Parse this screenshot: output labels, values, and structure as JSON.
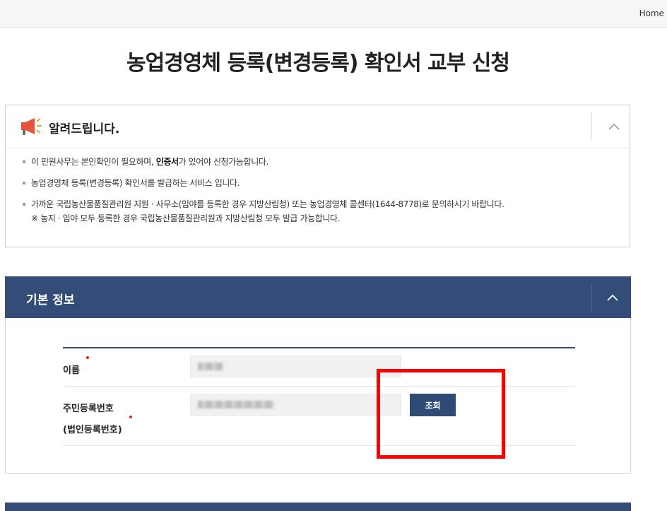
{
  "topbar": {
    "home_label": "Home"
  },
  "page": {
    "title": "농업경영체 등록(변경등록) 확인서 교부 신청"
  },
  "notice": {
    "title": "알려드립니다.",
    "icon": "megaphone-icon",
    "items": [
      {
        "pre": "이 민원사무는 본인확인이 필요하며, ",
        "bold": "인증서",
        "post": "가 있어야 신청가능합니다."
      },
      {
        "text": "농업경영체 등록(변경등록) 확인서를 발급하는 서비스 입니다."
      },
      {
        "text": "가까운 국립농산물품질관리원 지원 · 사무소(임야를 등록한 경우 지방산림청) 또는 농업경영체 콜센터(1644-8778)로 문의하시기 바랍니다.",
        "sub": "※ 농지 · 임야 모두 등록한 경우 국립농산물품질관리원과 지방산림청 모두 발급 가능합니다."
      }
    ]
  },
  "basic_info": {
    "title": "기본 정보",
    "name_label": "이름",
    "rrn_label": "주민등록번호",
    "rrn_label_sub": "(법인등록번호)",
    "search_button": "조회"
  },
  "colors": {
    "header_navy": "#334d78",
    "button_navy": "#2f4a75",
    "required_dot": "#e02020",
    "highlight_red": "#ff0000"
  }
}
